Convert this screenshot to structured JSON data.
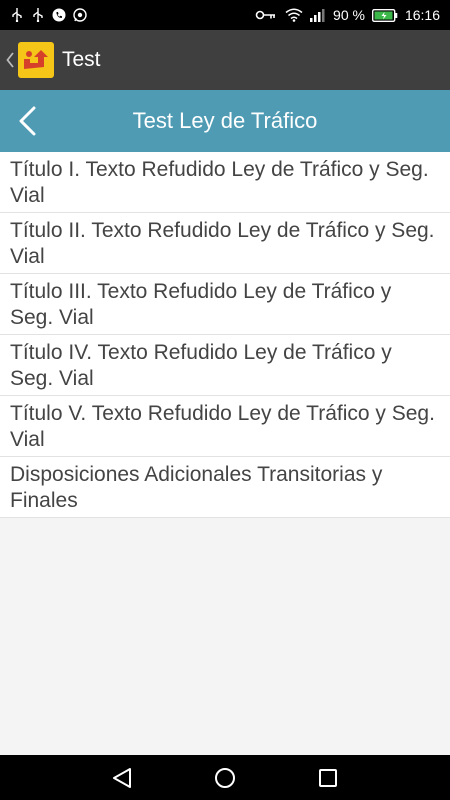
{
  "status_bar": {
    "battery_percent": "90 %",
    "time": "16:16",
    "icons": [
      "usb-icon",
      "usb-icon",
      "phone-icon",
      "whatsapp-icon",
      "key-icon",
      "wifi-icon",
      "signal-icon",
      "battery-icon"
    ]
  },
  "app_bar": {
    "title": "Test",
    "logo_color": "#f5c518"
  },
  "header": {
    "title": "Test Ley de Tráfico",
    "color": "#4f9bb4"
  },
  "list": {
    "items": [
      {
        "label": "Título I. Texto Refudido Ley de Tráfico y Seg. Vial"
      },
      {
        "label": "Título II. Texto Refudido Ley de Tráfico y Seg. Vial"
      },
      {
        "label": "Título III. Texto Refudido Ley de Tráfico y Seg. Vial"
      },
      {
        "label": "Título IV. Texto Refudido Ley de Tráfico y Seg. Vial"
      },
      {
        "label": "Título V. Texto Refudido Ley de Tráfico y Seg. Vial"
      },
      {
        "label": "Disposiciones Adicionales Transitorias y Finales"
      }
    ]
  },
  "nav_bar": {
    "buttons": [
      "back-triangle-icon",
      "home-circle-icon",
      "recents-square-icon"
    ]
  }
}
